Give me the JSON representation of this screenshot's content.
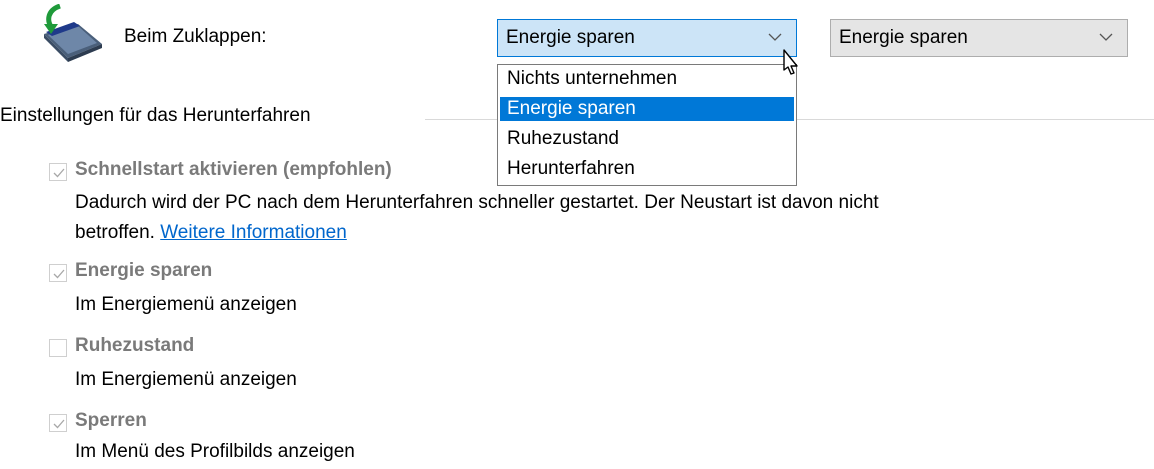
{
  "lid": {
    "label": "Beim Zuklappen:",
    "battery_value": "Energie sparen",
    "plugged_value": "Energie sparen",
    "options": [
      "Nichts unternehmen",
      "Energie sparen",
      "Ruhezustand",
      "Herunterfahren"
    ],
    "selected_option": "Energie sparen"
  },
  "shutdown": {
    "title": "Einstellungen für das Herunterfahren",
    "items": [
      {
        "label": "Schnellstart aktivieren (empfohlen)",
        "checked": true,
        "desc_line1": "Dadurch wird der PC nach dem Herunterfahren schneller gestartet. Der Neustart ist davon nicht",
        "desc_line2_prefix": "betroffen.",
        "link": "Weitere Informationen"
      },
      {
        "label": "Energie sparen",
        "checked": true,
        "desc": "Im Energiemenü anzeigen"
      },
      {
        "label": "Ruhezustand",
        "checked": false,
        "desc": "Im Energiemenü anzeigen"
      },
      {
        "label": "Sperren",
        "checked": true,
        "desc": "Im Menü des Profilbilds anzeigen"
      }
    ]
  },
  "colors": {
    "accent": "#0078d7",
    "link": "#0066cc",
    "disabled_text": "#7a7a7a"
  }
}
